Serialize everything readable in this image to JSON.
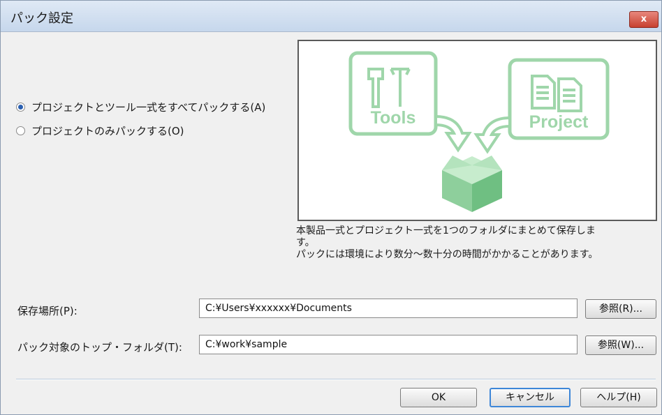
{
  "window": {
    "title": "パック設定",
    "close_label": "x"
  },
  "options": [
    {
      "label": "プロジェクトとツール一式をすべてパックする(A)",
      "selected": true
    },
    {
      "label": "プロジェクトのみパックする(O)",
      "selected": false
    }
  ],
  "illustration": {
    "tools_label": "Tools",
    "project_label": "Project",
    "accent_color": "#8ecf9c"
  },
  "description": {
    "line1": "本製品一式とプロジェクト一式を1つのフォルダにまとめて保存しま",
    "line2": "す。",
    "line3": "パックには環境により数分～数十分の時間がかかることがあります。"
  },
  "save_location": {
    "label": "保存場所(P):",
    "value": "C:¥Users¥xxxxxx¥Documents",
    "browse_label": "参照(R)..."
  },
  "top_folder": {
    "label": "パック対象のトップ・フォルダ(T):",
    "value": "C:¥work¥sample",
    "browse_label": "参照(W)..."
  },
  "footer": {
    "ok_label": "OK",
    "cancel_label": "キャンセル",
    "help_label": "ヘルプ(H)"
  }
}
